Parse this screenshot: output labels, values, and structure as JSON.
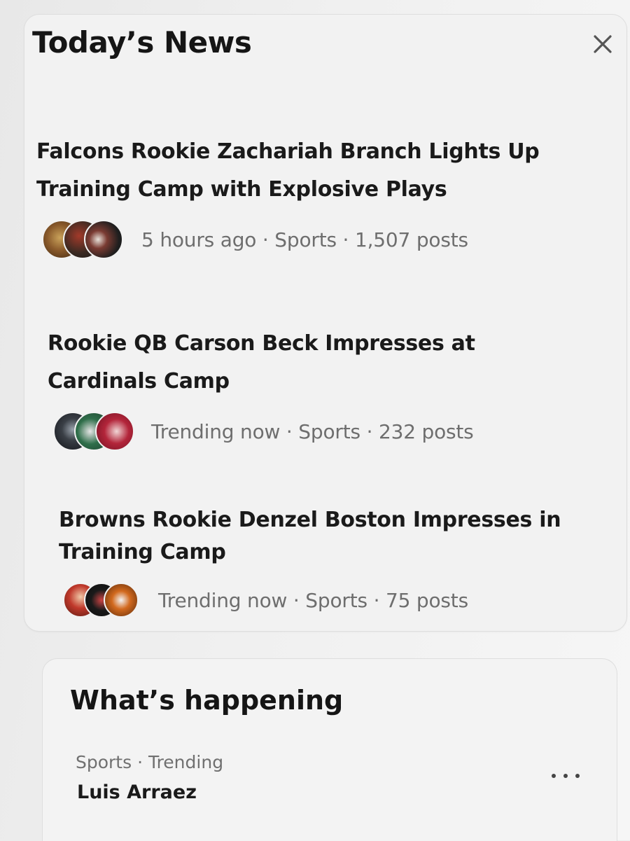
{
  "panel": {
    "title": "Today’s News"
  },
  "icons": {
    "close": "close-icon",
    "more": "more-horizontal-icon"
  },
  "stories": [
    {
      "headline_lines": [
        "Falcons Rookie Zachariah Branch Lights Up",
        "Training Camp with Explosive Plays"
      ],
      "meta": "5 hours ago · Sports · 1,507 posts",
      "avatar_colors": [
        "#8a5a2b",
        "#3b2a22",
        "#2c2c2c"
      ]
    },
    {
      "headline_lines": [
        "Rookie QB Carson Beck Impresses at",
        "Cardinals Camp"
      ],
      "meta": "Trending now · Sports · 232 posts",
      "avatar_colors": [
        "#1d1f24",
        "#2f6e4a",
        "#b3253a"
      ]
    },
    {
      "headline_lines": [
        "Browns Rookie Denzel Boston Impresses in",
        "Training Camp"
      ],
      "meta": "Trending now · Sports · 75 posts",
      "avatar_colors": [
        "#c0392b",
        "#1a1a1a",
        "#d2691e"
      ]
    }
  ],
  "whats_happening": {
    "title": "What’s happening",
    "trend": {
      "category": "Sports · Trending",
      "name": "Luis Arraez"
    }
  }
}
